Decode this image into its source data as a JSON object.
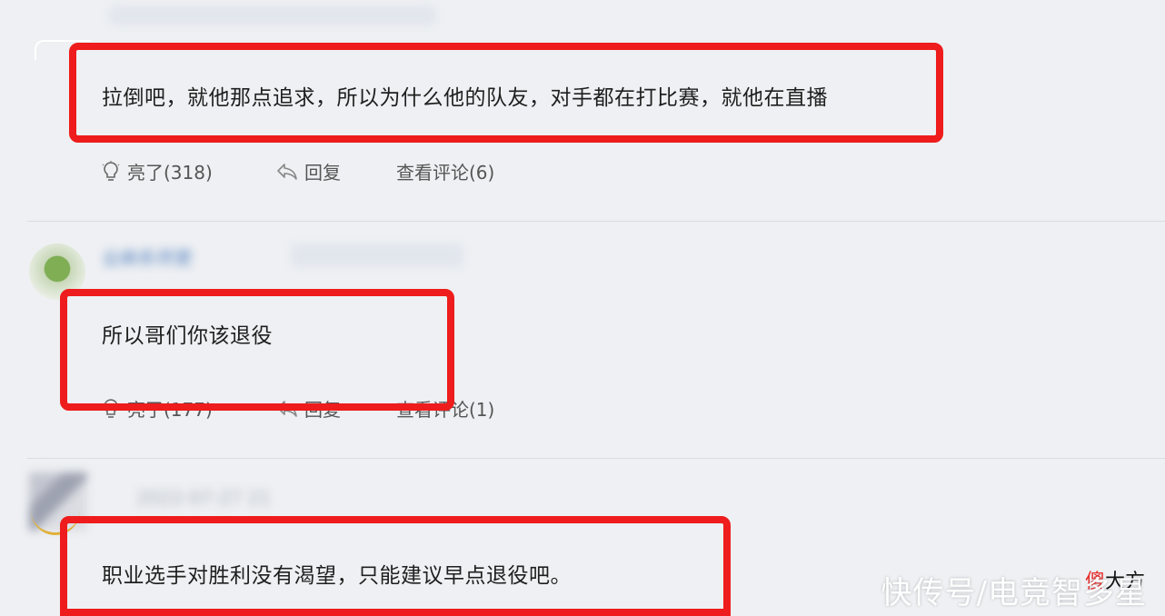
{
  "comments": [
    {
      "text": "拉倒吧，就他那点追求，所以为什么他的队友，对手都在打比赛，就他在直播",
      "actions": {
        "like_label": "亮了(318)",
        "reply_label": "回复",
        "view_label": "查看评论(6)"
      }
    },
    {
      "username": "业麻系师更",
      "text": "所以哥们你该退役",
      "actions": {
        "like_label": "亮了(177)",
        "reply_label": "回复",
        "view_label": "查看评论(1)"
      }
    },
    {
      "date": "2022-07-27 21",
      "text": "职业选手对胜利没有渴望，只能建议早点退役吧。"
    }
  ],
  "watermark": {
    "text": "快传号/电竞智多星",
    "logo_prefix": "傻",
    "logo_rest": "大方"
  },
  "colors": {
    "highlight_box": "#ee1c1c",
    "username": "#3b6fb6",
    "background": "#eef0f3"
  }
}
